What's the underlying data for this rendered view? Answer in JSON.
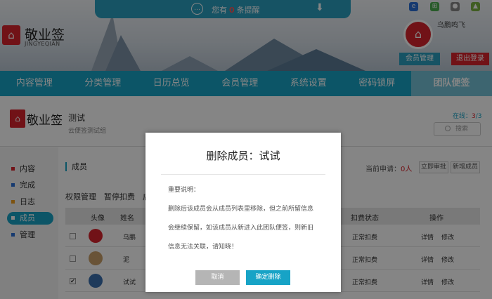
{
  "notice": {
    "prefix": "您有",
    "count": "0",
    "suffix": "条提醒"
  },
  "logo": {
    "name": "敬业签",
    "sub": "JINGYEQIAN"
  },
  "user": {
    "name": "乌鹏鸣飞",
    "member_btn": "会员管理",
    "logout_btn": "退出登录"
  },
  "nav": [
    "内容管理",
    "分类管理",
    "日历总览",
    "会员管理",
    "系统设置",
    "密码锁屏",
    "团队便签"
  ],
  "team": {
    "logo_name": "敬业签",
    "name": "测试",
    "desc": "云便签测试组",
    "online_label": "在线：",
    "online_count": "3",
    "online_total": "/3",
    "search_placeholder": "搜索"
  },
  "sidebar": [
    {
      "label": "内容",
      "color": "#d9232d"
    },
    {
      "label": "完成",
      "color": "#2b6fd6"
    },
    {
      "label": "日志",
      "color": "#f0a020"
    },
    {
      "label": "成员",
      "color": "#ffffff"
    },
    {
      "label": "管理",
      "color": "#2b6fd6"
    }
  ],
  "main": {
    "title": "成员",
    "apply_label": "当前申请：",
    "apply_count": "0人",
    "btn_audit": "立即审批",
    "btn_add": "新增成员",
    "tabs": "权限管理　暂停扣费　启",
    "headers": {
      "avatar": "头像",
      "name": "姓名",
      "status": "扣费状态",
      "op": "操作"
    },
    "rows": [
      {
        "name": "乌鹏",
        "status": "正常扣费",
        "detail": "详情",
        "edit": "修改",
        "checked": ""
      },
      {
        "name": "泥",
        "status": "正常扣费",
        "detail": "详情",
        "edit": "修改",
        "checked": ""
      },
      {
        "name": "试试",
        "status": "正常扣费",
        "detail": "详情",
        "edit": "修改",
        "checked": "✔"
      }
    ]
  },
  "modal": {
    "title": "删除成员：试试",
    "label": "重要说明：",
    "body": "删除后该成员会从成员列表里移除，但之前所留信息会继续保留，如该成员从新进入此团队便签，则新旧信息无法关联，请知晓！",
    "cancel": "取消",
    "confirm": "确定删除"
  }
}
